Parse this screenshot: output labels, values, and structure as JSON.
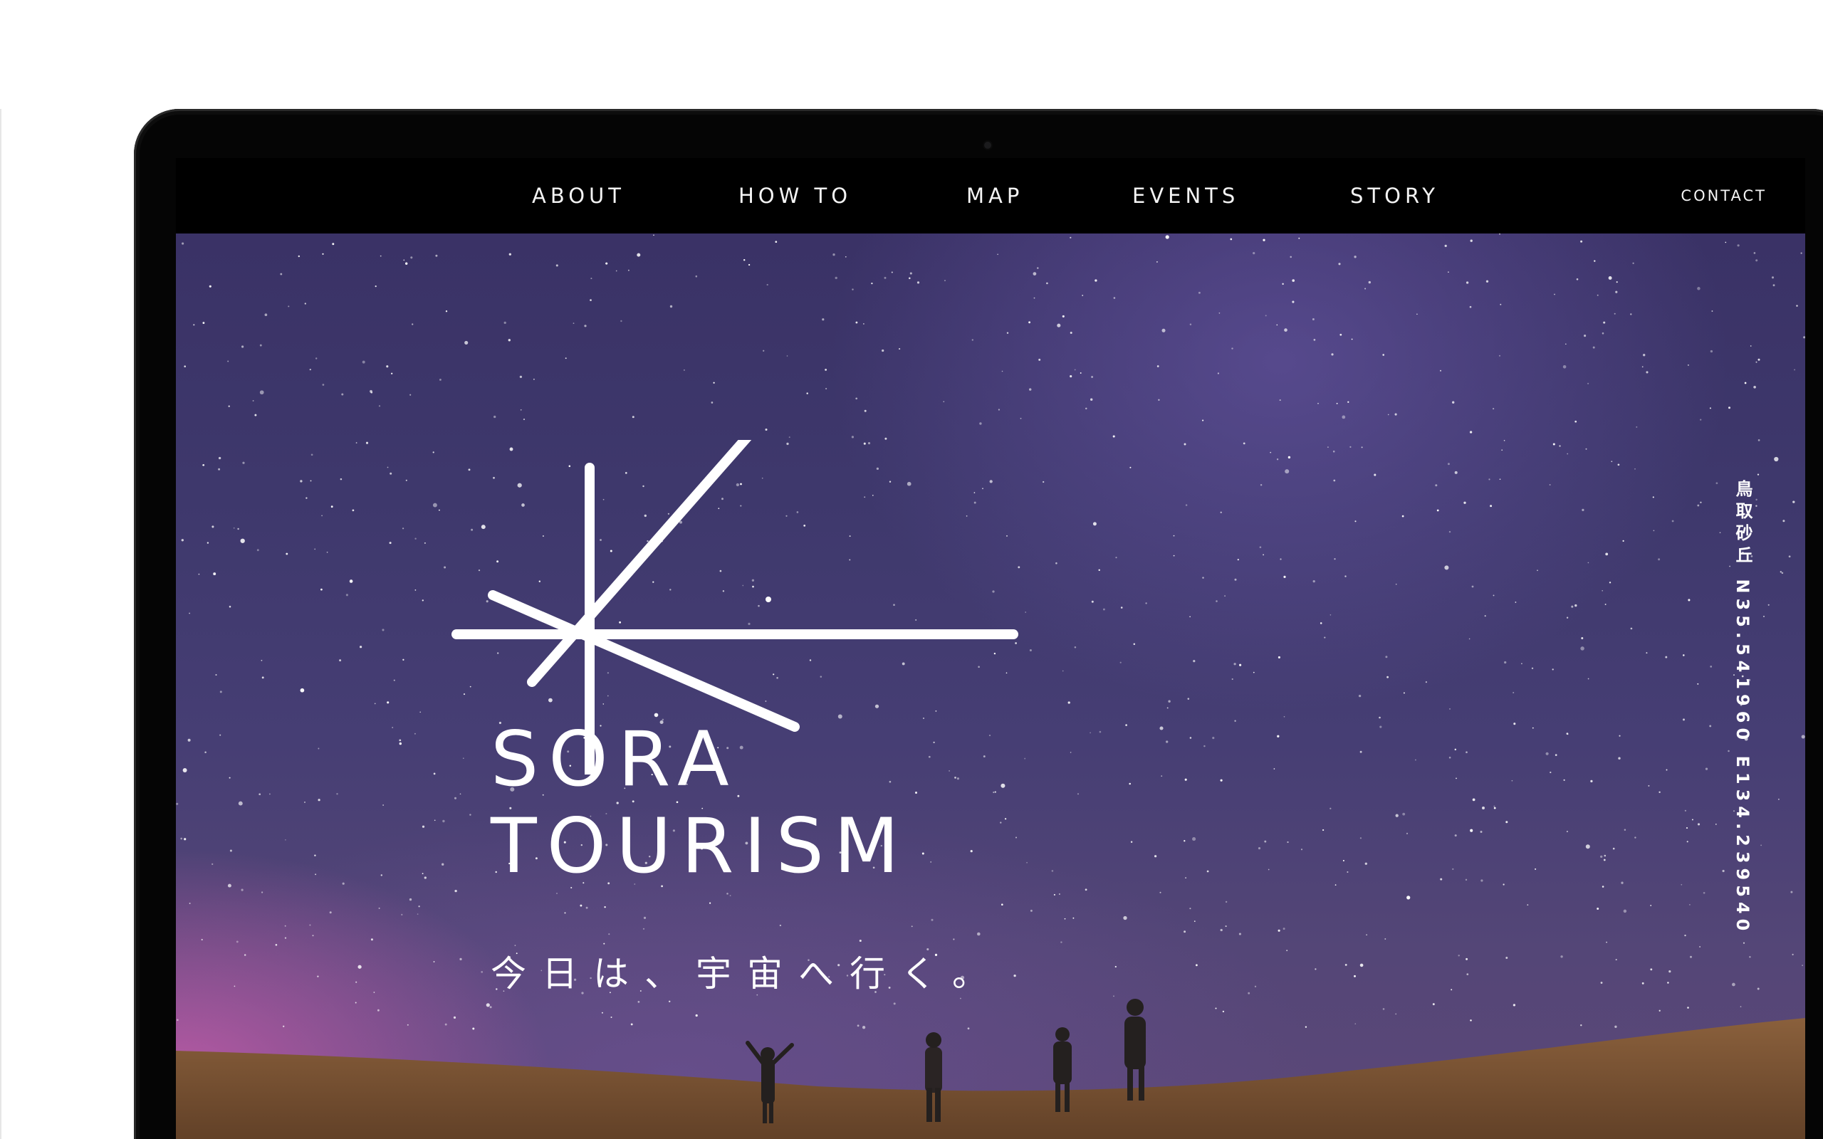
{
  "nav": {
    "items": [
      {
        "label": "ABOUT"
      },
      {
        "label": "HOW TO"
      },
      {
        "label": "MAP"
      },
      {
        "label": "EVENTS"
      },
      {
        "label": "STORY"
      }
    ],
    "contact_label": "CONTACT"
  },
  "hero": {
    "logo_line1": "SORA",
    "logo_line2": "TOURISM",
    "tagline": "今日は、宇宙へ行く。",
    "location_coordinates": "鳥取砂丘 N35.541960 E134.239540",
    "logo_icon": "starburst-icon"
  },
  "colors": {
    "nav_background": "#000000",
    "text": "#ffffff",
    "sky_top": "#3a3266",
    "sky_horizon": "#c45caa",
    "sand": "#7c5637"
  }
}
